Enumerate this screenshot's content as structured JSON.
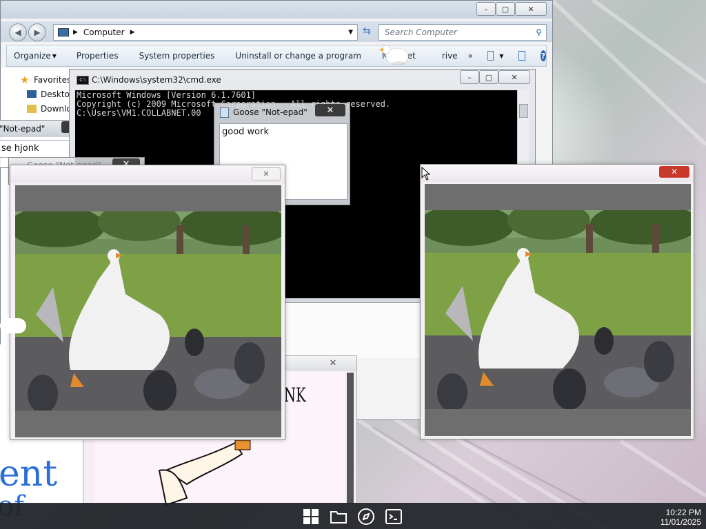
{
  "explorer": {
    "breadcrumb": "Computer",
    "search_placeholder": "Search Computer",
    "toolbar": [
      "Organize",
      "Properties",
      "System properties",
      "Uninstall or change a program",
      "Map net",
      "rive",
      "»"
    ],
    "nav": [
      "Favorites",
      "Desktop",
      "Downlo"
    ]
  },
  "cmd": {
    "title": "C:\\Windows\\system32\\cmd.exe",
    "lines": [
      "Microsoft Windows [Version 6.1.7601]",
      "Copyright (c) 2009 Microsoft Corporation.  All rights reserved.",
      "",
      "C:\\Users\\VM1.COLLABNET.00"
    ]
  },
  "notepad_front": {
    "title": "Goose \"Not-epad\"",
    "text": "good work"
  },
  "notepad_left": {
    "title": "\"Not-epad\"",
    "text": "se hjonk"
  },
  "notepad_left2": {
    "title": "Goose \"Not-epad\""
  },
  "bottom_note": {
    "text": "NK"
  },
  "handwriting": {
    "line1": "ent",
    "line2": "of"
  },
  "taskbar": {
    "icons": [
      "windows-start-icon",
      "folder-icon",
      "compass-icon",
      "terminal-icon"
    ],
    "time": "10:22 PM",
    "date": "11/01/2025"
  },
  "colors": {
    "close_red": "#c8392b",
    "console_bg": "#000000",
    "taskbar_bg": "#1e2226"
  }
}
